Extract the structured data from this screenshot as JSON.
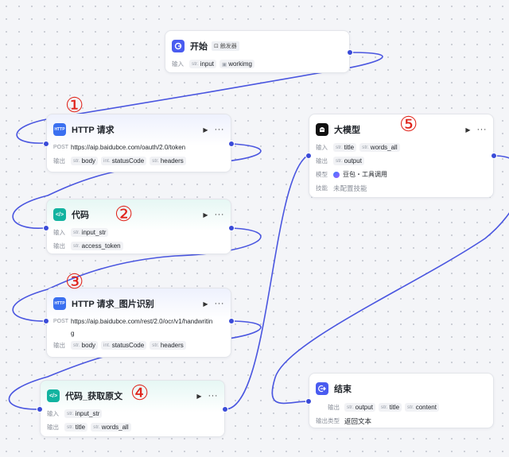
{
  "colors": {
    "edge": "#4a56e0",
    "port": "#3a4bd8",
    "start_icon": "#4a5cf0",
    "http_icon": "#3a6ff0",
    "code_icon": "#12b3a0",
    "llm_icon": "#111111",
    "end_icon": "#4a5cf0",
    "annotation": "#e0241b"
  },
  "annotations": [
    "①",
    "②",
    "③",
    "④",
    "⑤"
  ],
  "start": {
    "title": "开始",
    "trigger": "触发器",
    "icon": "start-icon",
    "input_label": "输入",
    "vars": [
      {
        "type": "str.",
        "name": "input"
      },
      {
        "type": "img",
        "name": "workimg"
      }
    ]
  },
  "http1": {
    "icon_text": "HTTP",
    "title": "HTTP 请求",
    "method": "POST",
    "url": "https://aip.baidubce.com/oauth/2.0/token",
    "output_label": "输出",
    "outputs": [
      {
        "type": "str.",
        "name": "body"
      },
      {
        "type": "int.",
        "name": "statusCode"
      },
      {
        "type": "str.",
        "name": "headers"
      }
    ]
  },
  "code1": {
    "icon_text": "</>",
    "title": "代码",
    "input_label": "输入",
    "output_label": "输出",
    "inputs": [
      {
        "type": "str.",
        "name": "input_str"
      }
    ],
    "outputs": [
      {
        "type": "str.",
        "name": "access_token"
      }
    ]
  },
  "http2": {
    "icon_text": "HTTP",
    "title": "HTTP 请求_图片识别",
    "method": "POST",
    "url_line1": "https://aip.baidubce.com/rest/2.0/ocr/v1/handwritin",
    "url_line2": "g",
    "output_label": "输出",
    "outputs": [
      {
        "type": "str.",
        "name": "body"
      },
      {
        "type": "int.",
        "name": "statusCode"
      },
      {
        "type": "str.",
        "name": "headers"
      }
    ]
  },
  "code2": {
    "icon_text": "</>",
    "title": "代码_获取原文",
    "input_label": "输入",
    "output_label": "输出",
    "inputs": [
      {
        "type": "str.",
        "name": "input_str"
      }
    ],
    "outputs": [
      {
        "type": "str.",
        "name": "title"
      },
      {
        "type": "str.",
        "name": "words_all"
      }
    ]
  },
  "llm": {
    "title": "大模型",
    "input_label": "输入",
    "output_label": "输出",
    "model_label": "模型",
    "skill_label": "技能",
    "inputs": [
      {
        "type": "str.",
        "name": "title"
      },
      {
        "type": "str.",
        "name": "words_all"
      }
    ],
    "outputs": [
      {
        "type": "str.",
        "name": "output"
      }
    ],
    "model": "豆包・工具调用",
    "skill": "未配置技能"
  },
  "end": {
    "title": "结束",
    "output_label": "输出",
    "type_label": "输出类型",
    "outputs": [
      {
        "type": "str.",
        "name": "output"
      },
      {
        "type": "str.",
        "name": "title"
      },
      {
        "type": "str.",
        "name": "content"
      }
    ],
    "output_type": "返回文本"
  }
}
